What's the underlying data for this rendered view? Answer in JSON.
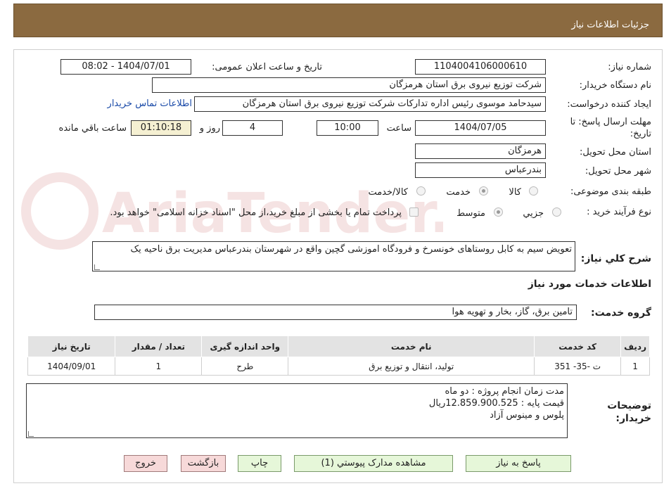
{
  "header": {
    "title": "جزئیات اطلاعات نیاز"
  },
  "labels": {
    "need_number": "شماره نیاز:",
    "announce_datetime": "تاریخ و ساعت اعلان عمومی:",
    "buyer_org": "نام دستگاه خریدار:",
    "requester": "ایجاد کننده درخواست:",
    "deadline": "مهلت ارسال پاسخ: تا تاریخ:",
    "time_word": "ساعت",
    "day_word": "روز و",
    "remaining_word": "ساعت باقي مانده",
    "province": "استان محل تحویل:",
    "city": "شهر محل تحویل:",
    "category": "طبقه بندی موضوعی:",
    "purchase_type": "نوع فرآیند خرید :",
    "overall_desc": "شرح کلي نیاز:",
    "services_info": "اطلاعات خدمات مورد نیاز",
    "service_group": "گروه خدمت:",
    "buyer_notes": "توضیحات خریدار:"
  },
  "values": {
    "need_number": "1104004106000610",
    "announce_datetime": "1404/07/01 - 08:02",
    "buyer_org": "شرکت توزیع نیروی برق استان هرمزگان",
    "requester": "سیدحامد موسوی رئیس اداره تدارکات شرکت توزیع نیروی برق استان هرمزگان",
    "contact_link": "اطلاعات تماس خریدار",
    "deadline_date": "1404/07/05",
    "deadline_time": "10:00",
    "days": "4",
    "remaining": "01:10:18",
    "province": "هرمزگان",
    "city": "بندرعباس",
    "overall_desc": "تعویض سیم به کابل روستاهای خونسرخ و فرودگاه اموزشی گچین واقع در شهرستان بندرعباس مدیریت برق ناحیه یک",
    "service_group": "تامین برق، گاز، بخار و تهویه هوا",
    "buyer_notes": [
      "مدت زمان انجام پروژه : دو ماه",
      "قیمت پایه : 12.859.900.525ریال",
      "پلوس و مینوس آزاد"
    ]
  },
  "category_options": [
    {
      "label": "کالا",
      "selected": false
    },
    {
      "label": "خدمت",
      "selected": true
    },
    {
      "label": "کالا/خدمت",
      "selected": false
    }
  ],
  "purchase_options": [
    {
      "label": "جزيي",
      "selected": false
    },
    {
      "label": "متوسط",
      "selected": true
    }
  ],
  "payment_note": "پرداخت تمام یا بخشی از مبلغ خرید،از محل \"اسناد خزانه اسلامی\" خواهد بود.",
  "table": {
    "headers": [
      "ردیف",
      "کد خدمت",
      "نام خدمت",
      "واحد اندازه گیری",
      "تعداد / مقدار",
      "تاریخ نیاز"
    ],
    "rows": [
      [
        "1",
        "ت -35- 351",
        "تولید، انتقال و توزیع برق",
        "طرح",
        "1",
        "1404/09/01"
      ]
    ]
  },
  "buttons": {
    "reply": "پاسخ به نیاز",
    "view_docs": "مشاهده مدارک پیوستي (1)",
    "print": "چاپ",
    "back": "بازگشت",
    "exit": "خروج"
  },
  "watermark": {
    "text": "AriaTender.neT"
  },
  "colors": {
    "header_bg": "#8b6a40",
    "link": "#1a4aa8",
    "btn_green": "#e6f7d9",
    "btn_pink": "#f7d9d9"
  }
}
